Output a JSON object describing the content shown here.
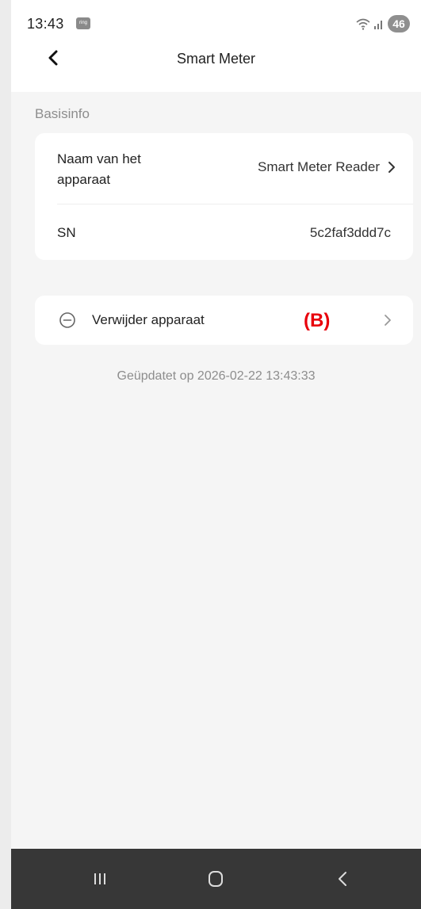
{
  "status_bar": {
    "time": "13:43",
    "app_icon": "ring-notification-icon",
    "battery": "46"
  },
  "header": {
    "title": "Smart Meter"
  },
  "basis_section": {
    "label": "Basisinfo",
    "name_label": "Naam van het apparaat",
    "name_value": "Smart Meter Reader",
    "sn_label": "SN",
    "sn_value": "5c2faf3ddd7c"
  },
  "remove": {
    "label": "Verwijder apparaat",
    "marker": "(B)"
  },
  "footer": {
    "updated": "Geüpdatet op 2026-02-22 13:43:33"
  },
  "colors": {
    "marker": "#e8000b",
    "background": "#f5f5f5",
    "navbar": "#373737"
  }
}
